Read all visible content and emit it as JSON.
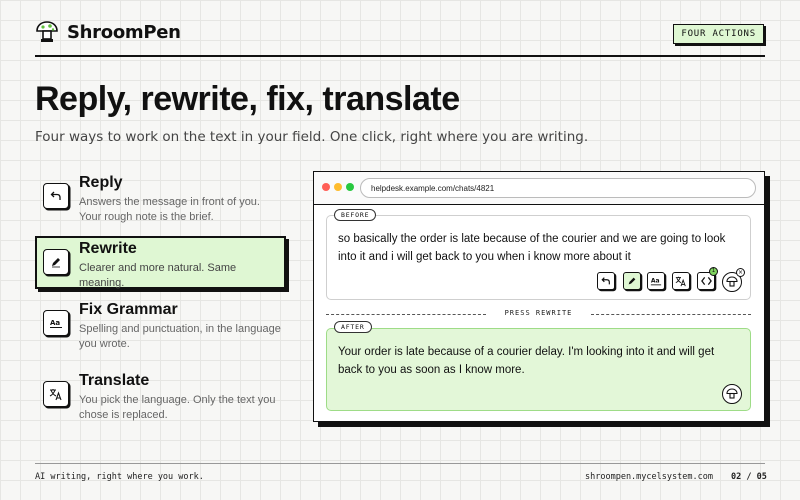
{
  "header": {
    "brand": "ShroomPen",
    "badge": "FOUR ACTIONS"
  },
  "hero": {
    "title": "Reply, rewrite, fix, translate",
    "subtitle": "Four ways to work on the text in your field. One click, right where you are writing."
  },
  "features": [
    {
      "icon": "reply-icon",
      "title": "Reply",
      "desc_1": "Answers the message in front of you.",
      "desc_2": "Your rough note is the brief."
    },
    {
      "icon": "rewrite-icon",
      "title": "Rewrite",
      "desc_1": "Clearer and more natural. Same meaning.",
      "desc_2": ""
    },
    {
      "icon": "grammar-icon",
      "title": "Fix Grammar",
      "desc_1": "Spelling and punctuation, in the language",
      "desc_2": "you wrote."
    },
    {
      "icon": "translate-icon",
      "title": "Translate",
      "desc_1": "You pick the language. Only the text you",
      "desc_2": "chose is replaced."
    }
  ],
  "browser": {
    "url": "helpdesk.example.com/chats/4821",
    "before_label": "BEFORE",
    "before_text": "so basically the order is late because of the courier and we are going to look into it and i will get back to you when i know more about it",
    "press_label": "PRESS REWRITE",
    "after_label": "AFTER",
    "after_text": "Your order is late because of a courier delay. I'm looking into it and will get back to you as soon as I know more.",
    "badge_count": "1",
    "close_glyph": "×",
    "grammar_glyph": "Aa"
  },
  "footer": {
    "tagline": "AI writing, right where you work.",
    "site": "shroompen.mycelsystem.com",
    "page": "02 / 05"
  },
  "colors": {
    "accent_green": "#dff7d3",
    "after_green": "#e3f7d8",
    "ink": "#111111"
  }
}
